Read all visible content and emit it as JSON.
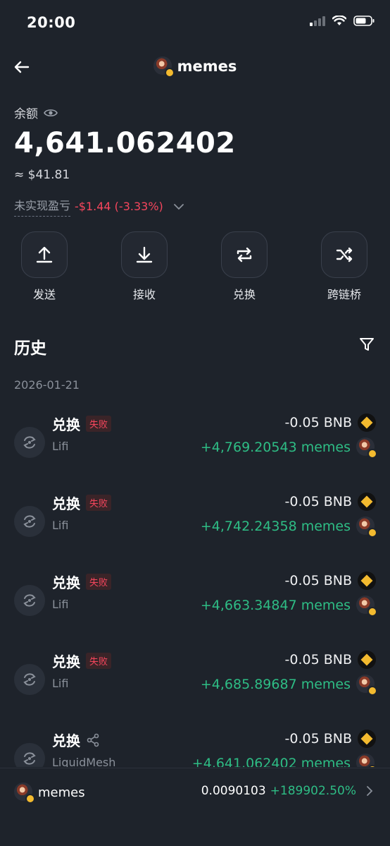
{
  "status": {
    "time": "20:00"
  },
  "header": {
    "title": "memes"
  },
  "balance": {
    "label": "余额",
    "amount": "4,641.062402",
    "usd": "≈ $41.81",
    "pnl_label": "未实现盈亏",
    "pnl_value": "-$1.44 (-3.33%)"
  },
  "actions": [
    {
      "label": "发送",
      "icon": "upload-icon"
    },
    {
      "label": "接收",
      "icon": "download-icon"
    },
    {
      "label": "兑换",
      "icon": "swap-icon"
    },
    {
      "label": "跨链桥",
      "icon": "shuffle-icon"
    }
  ],
  "history": {
    "title": "历史",
    "date": "2026-01-21",
    "items": [
      {
        "type": "兑换",
        "status": "失败",
        "provider": "Lifi",
        "out": "-0.05 BNB",
        "in": "+4,769.20543 memes"
      },
      {
        "type": "兑换",
        "status": "失败",
        "provider": "Lifi",
        "out": "-0.05 BNB",
        "in": "+4,742.24358 memes"
      },
      {
        "type": "兑换",
        "status": "失败",
        "provider": "Lifi",
        "out": "-0.05 BNB",
        "in": "+4,663.34847 memes"
      },
      {
        "type": "兑换",
        "status": "失败",
        "provider": "Lifi",
        "out": "-0.05 BNB",
        "in": "+4,685.89687 memes"
      },
      {
        "type": "兑换",
        "status": "",
        "provider": "LiquidMesh",
        "out": "-0.05 BNB",
        "in": "+4,641.062402 memes"
      }
    ]
  },
  "bottom": {
    "name": "memes",
    "price": "0.0090103",
    "change": "+189902.50%"
  },
  "colors": {
    "bg": "#1e232b",
    "positive": "#2ebd85",
    "negative": "#f6465d",
    "bnb": "#f3ba2f"
  }
}
